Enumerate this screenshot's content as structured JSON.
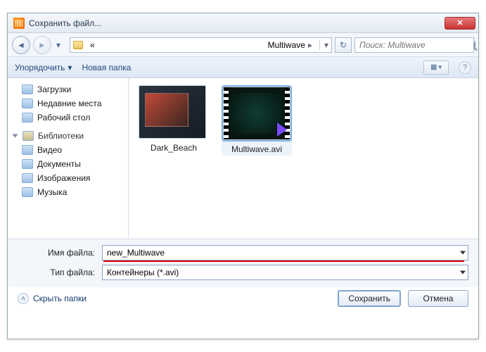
{
  "window": {
    "title": "Сохранить файл..."
  },
  "address": {
    "segment_blank": "«",
    "segment_main": "Multiwave"
  },
  "search": {
    "placeholder": "Поиск: Multiwave"
  },
  "toolbar": {
    "organize": "Упорядочить",
    "new_folder": "Новая папка"
  },
  "sidebar": {
    "quick": {
      "items": [
        "Загрузки",
        "Недавние места",
        "Рабочий стол"
      ]
    },
    "libraries": {
      "header": "Библиотеки",
      "items": [
        "Видео",
        "Документы",
        "Изображения",
        "Музыка"
      ]
    }
  },
  "content": {
    "items": [
      {
        "label": "Dark_Beach",
        "kind": "folder",
        "selected": false
      },
      {
        "label": "Multiwave.avi",
        "kind": "video",
        "selected": true
      }
    ]
  },
  "fields": {
    "filename_label": "Имя файла:",
    "filename_value": "new_Multiwave",
    "filetype_label": "Тип файла:",
    "filetype_value": "Контейнеры (*.avi)"
  },
  "footer": {
    "hide_folders": "Скрыть папки",
    "save": "Сохранить",
    "cancel": "Отмена"
  }
}
